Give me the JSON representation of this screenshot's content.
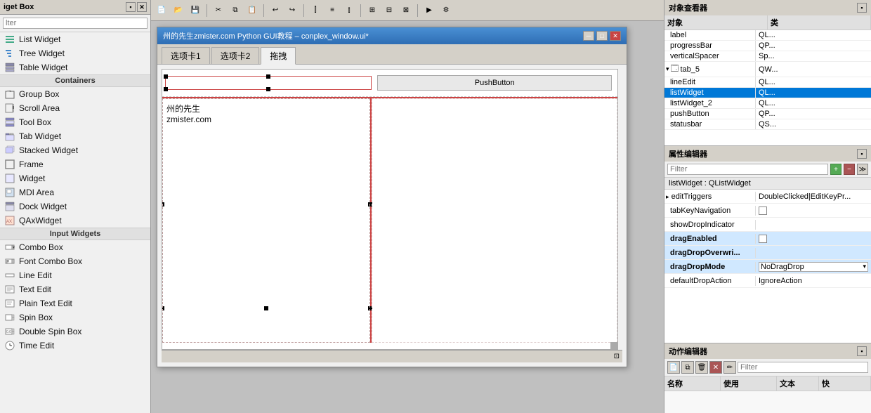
{
  "leftPanel": {
    "title": "iget Box",
    "filterPlaceholder": "lter",
    "sections": [
      {
        "type": "items",
        "items": [
          {
            "label": "List Widget",
            "icon": "list"
          },
          {
            "label": "Tree Widget",
            "icon": "tree"
          },
          {
            "label": "Table Widget",
            "icon": "table"
          }
        ]
      },
      {
        "type": "category",
        "label": "Containers"
      },
      {
        "type": "items",
        "items": [
          {
            "label": "Group Box",
            "icon": "groupbox"
          },
          {
            "label": "Scroll Area",
            "icon": "scroll"
          },
          {
            "label": "Tool Box",
            "icon": "toolbox"
          },
          {
            "label": "Tab Widget",
            "icon": "tab"
          },
          {
            "label": "Stacked Widget",
            "icon": "stacked"
          },
          {
            "label": "Frame",
            "icon": "frame"
          },
          {
            "label": "Widget",
            "icon": "widget"
          },
          {
            "label": "MDI Area",
            "icon": "mdi"
          },
          {
            "label": "Dock Widget",
            "icon": "dock"
          },
          {
            "label": "QAxWidget",
            "icon": "qax"
          }
        ]
      },
      {
        "type": "category",
        "label": "Input Widgets"
      },
      {
        "type": "items",
        "items": [
          {
            "label": "Combo Box",
            "icon": "combo"
          },
          {
            "label": "Font Combo Box",
            "icon": "fontcombo"
          },
          {
            "label": "Line Edit",
            "icon": "lineedit"
          },
          {
            "label": "Text Edit",
            "icon": "textedit"
          },
          {
            "label": "Plain Text Edit",
            "icon": "plaintextedit"
          },
          {
            "label": "Spin Box",
            "icon": "spinbox"
          },
          {
            "label": "Double Spin Box",
            "icon": "doublespinbox"
          },
          {
            "label": "Time Edit",
            "icon": "timeedit"
          }
        ]
      }
    ]
  },
  "designerWindow": {
    "title": "州的先生zmister.com Python GUI教程 – conplex_window.ui*",
    "tabs": [
      "选项卡1",
      "选项卡2",
      "拖拽"
    ],
    "activeTab": 2,
    "pushButtonLabel": "PushButton",
    "textLines": [
      "州的先生",
      "zmister.com"
    ]
  },
  "rightPanel": {
    "objectInspectorTitle": "对象查看器",
    "objectColumns": [
      "对象",
      "类"
    ],
    "objects": [
      {
        "name": "label",
        "type": "QL...",
        "indent": 0
      },
      {
        "name": "progressBar",
        "type": "QP...",
        "indent": 0
      },
      {
        "name": "verticalSpacer",
        "type": "Sp...",
        "indent": 0
      },
      {
        "name": "tab_5",
        "type": "QW...",
        "indent": 1,
        "expanded": true
      },
      {
        "name": "lineEdit",
        "type": "QL...",
        "indent": 0
      },
      {
        "name": "listWidget",
        "type": "QL...",
        "indent": 0,
        "selected": true
      },
      {
        "name": "listWidget_2",
        "type": "QL...",
        "indent": 0
      },
      {
        "name": "pushButton",
        "type": "QP...",
        "indent": 0
      },
      {
        "name": "statusbar",
        "type": "QS...",
        "indent": 0
      }
    ],
    "propertyEditorTitle": "属性编辑器",
    "propertyFilterPlaceholder": "Filter",
    "propertyWidgetLabel": "listWidget : QListWidget",
    "properties": [
      {
        "name": "editTriggers",
        "value": "DoubleClicked|EditKeyPr...",
        "highlighted": false,
        "type": "text"
      },
      {
        "name": "tabKeyNavigation",
        "value": "",
        "highlighted": false,
        "type": "checkbox",
        "checked": false
      },
      {
        "name": "showDropIndicator",
        "value": "",
        "highlighted": false,
        "type": "none"
      },
      {
        "name": "dragEnabled",
        "value": "",
        "highlighted": true,
        "type": "checkbox",
        "checked": false
      },
      {
        "name": "dragDropOverwri...",
        "value": "",
        "highlighted": true,
        "type": "none"
      },
      {
        "name": "dragDropMode",
        "value": "NoDragDrop",
        "highlighted": true,
        "type": "dropdown"
      },
      {
        "name": "defaultDropAction",
        "value": "IgnoreAction",
        "highlighted": false,
        "type": "text"
      }
    ],
    "actionEditorTitle": "动作编辑器",
    "actionFilterPlaceholder": "Filter",
    "actionColumns": [
      "名称",
      "使用",
      "文本",
      "快"
    ]
  }
}
